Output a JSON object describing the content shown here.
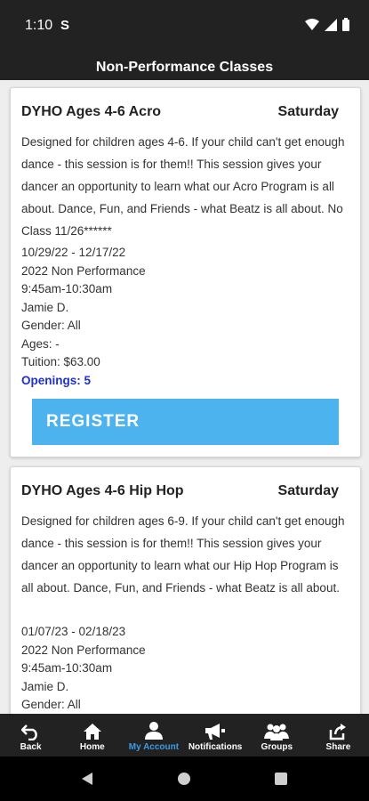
{
  "status_bar": {
    "time": "1:10",
    "notif_icon": "S"
  },
  "header": {
    "title": "Non-Performance Classes"
  },
  "cards": [
    {
      "title": "DYHO Ages 4-6 Acro",
      "day": "Saturday",
      "description": "Designed for children ages 4-6. If your child can't get enough dance - this session is for them!! This session gives your dancer an opportunity to learn what our Acro Program is all about. Dance, Fun, and Friends - what Beatz is all about. No Class 11/26******",
      "dates": "10/29/22 - 12/17/22",
      "season": "2022 Non Performance",
      "time": "9:45am-10:30am",
      "instructor": "Jamie D.",
      "gender": "Gender: All",
      "ages": "Ages: -",
      "tuition": "Tuition: $63.00",
      "openings": "Openings: 5",
      "register_label": "REGISTER"
    },
    {
      "title": "DYHO Ages 4-6 Hip Hop",
      "day": "Saturday",
      "description": "Designed for children ages 6-9. If your child can't get enough dance - this session is for them!! This session gives your dancer an opportunity to learn what our Hip Hop Program is all about. Dance, Fun, and Friends - what Beatz is all about.",
      "dates": "01/07/23 - 02/18/23",
      "season": "2022 Non Performance",
      "time": "9:45am-10:30am",
      "instructor": "Jamie D.",
      "gender": "Gender: All"
    }
  ],
  "bottom_nav": [
    {
      "label": "Back",
      "icon": "back-arrow-icon"
    },
    {
      "label": "Home",
      "icon": "home-icon"
    },
    {
      "label": "My Account",
      "icon": "person-icon",
      "active": true
    },
    {
      "label": "Notifications",
      "icon": "megaphone-icon"
    },
    {
      "label": "Groups",
      "icon": "groups-icon"
    },
    {
      "label": "Share",
      "icon": "share-icon"
    }
  ],
  "colors": {
    "bar": "#222222",
    "accent": "#4db3ee",
    "active_nav": "#3c9be6",
    "openings": "#1f2fd0"
  }
}
